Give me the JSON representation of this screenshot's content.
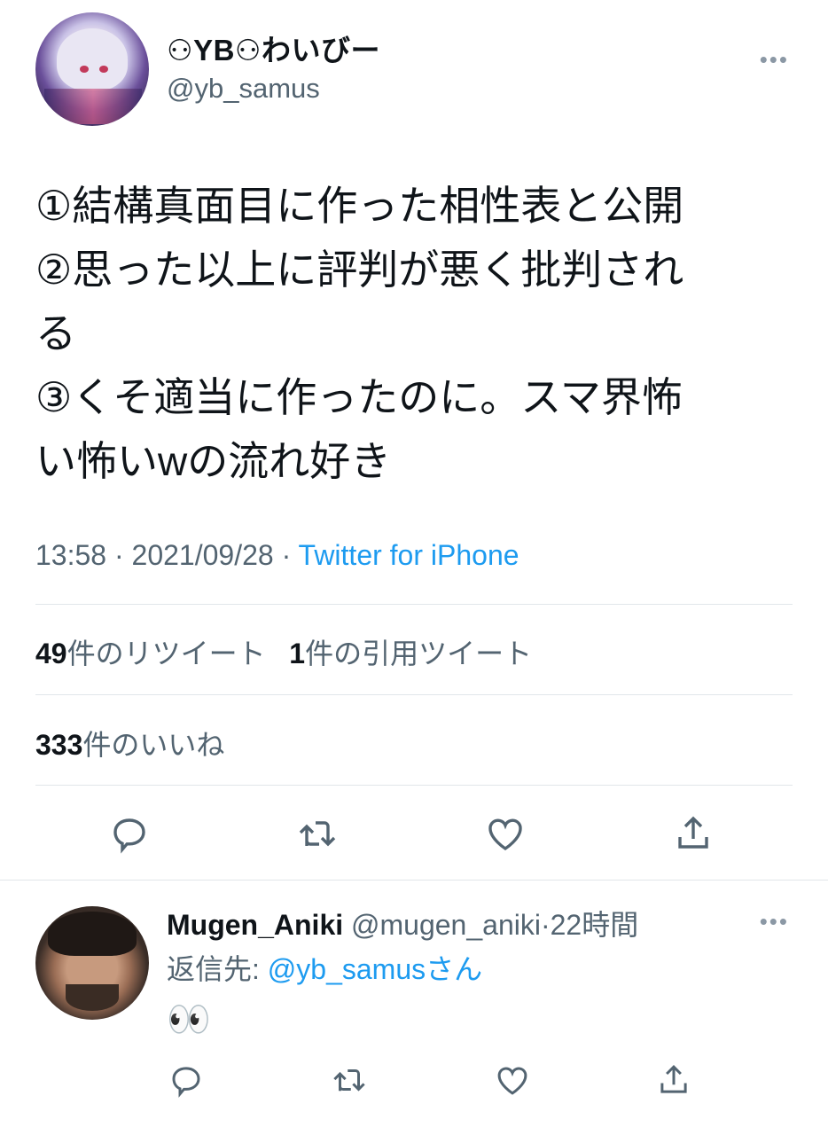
{
  "tweet": {
    "author": {
      "display_name": "⚇YB⚇わいびー",
      "handle": "@yb_samus",
      "avatar": "anime-avatar-icon"
    },
    "lines": [
      "①結構真面目に作った相性表と公開",
      "②思った以上に評判が悪く批判され",
      "る",
      "③くそ適当に作ったのに。スマ界怖",
      "い怖いwの流れ好き"
    ],
    "time": "13:58",
    "date": "2021/09/28",
    "separator": "·",
    "source": "Twitter for iPhone",
    "retweets_count": "49",
    "retweets_label": "件のリツイート",
    "quotes_count": "1",
    "quotes_label": "件の引用ツイート",
    "likes_count": "333",
    "likes_label": "件のいいね",
    "more_icon": "•••"
  },
  "actions": [
    "reply-icon",
    "retweet-icon",
    "like-icon",
    "share-icon"
  ],
  "reply": {
    "display_name": "Mugen_Aniki",
    "handle": "@mugen_aniki",
    "time": "22時間",
    "separator": "·",
    "reply_to_label": "返信先: ",
    "reply_to_mention": "@yb_samusさん",
    "body": "👀",
    "more_icon": "•••"
  },
  "colors": {
    "text": "#0f1419",
    "secondary": "#536471",
    "link": "#1d9bf0",
    "divider": "#e1e6ea"
  }
}
